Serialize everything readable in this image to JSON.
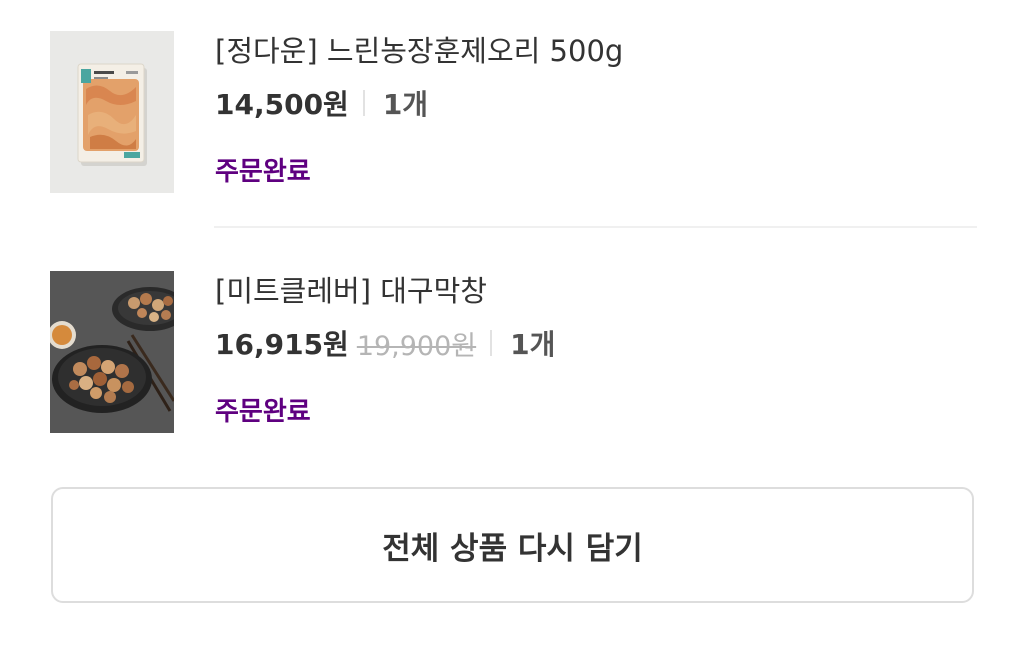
{
  "orders": [
    {
      "name": "[정다운] 느린농장훈제오리 500g",
      "price": "14,500원",
      "original_price": "",
      "quantity": "1개",
      "status": "주문완료",
      "image_icon": "smoked-duck-package-image"
    },
    {
      "name": "[미트클레버] 대구막창",
      "price": "16,915원",
      "original_price": "19,900원",
      "quantity": "1개",
      "status": "주문완료",
      "image_icon": "grilled-makchang-plate-image"
    }
  ],
  "actions": {
    "reorder_all_label": "전체 상품 다시 담기"
  },
  "colors": {
    "status_purple": "#5f0080",
    "text_primary": "#333333",
    "strike_gray": "#b5b5b5",
    "border_gray": "#dddddd"
  }
}
